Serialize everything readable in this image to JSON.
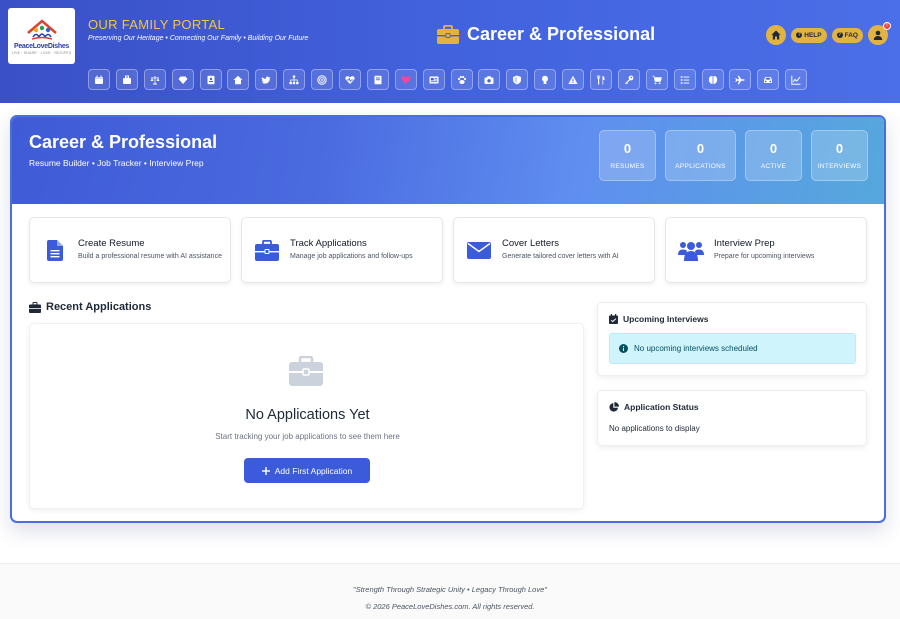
{
  "header": {
    "logo": {
      "brand": "PeaceLoveDishes",
      "tagline": "LIVE · SHARE · LOVE · RECIPES"
    },
    "portal_title": "OUR FAMILY PORTAL",
    "tagline": "Preserving Our Heritage • Connecting Our Family • Building Our Future",
    "page_title": "Career & Professional",
    "page_icon": "briefcase-icon",
    "buttons": {
      "home": "home-icon",
      "help": "HELP",
      "faq": "FAQ",
      "user": "user-icon"
    },
    "notification_badge": "!",
    "nav_icons": [
      "calendar",
      "briefcase",
      "scale",
      "gem",
      "id-card",
      "home",
      "twitter",
      "sitemap",
      "target",
      "heartbeat",
      "book",
      "heart",
      "newspaper",
      "paw",
      "camera",
      "shield",
      "lightbulb",
      "warning",
      "utensils",
      "key",
      "cart",
      "list",
      "brain",
      "plane",
      "car",
      "chart"
    ]
  },
  "hero": {
    "title": "Career & Professional",
    "subtitle": "Resume Builder • Job Tracker • Interview Prep",
    "stats": [
      {
        "value": "0",
        "label": "RESUMES"
      },
      {
        "value": "0",
        "label": "APPLICATIONS"
      },
      {
        "value": "0",
        "label": "ACTIVE"
      },
      {
        "value": "0",
        "label": "INTERVIEWS"
      }
    ]
  },
  "actions": [
    {
      "title": "Create Resume",
      "desc": "Build a professional resume with AI assistance",
      "icon": "document-icon"
    },
    {
      "title": "Track Applications",
      "desc": "Manage job applications and follow-ups",
      "icon": "briefcase-icon"
    },
    {
      "title": "Cover Letters",
      "desc": "Generate tailored cover letters with AI",
      "icon": "envelope-icon"
    },
    {
      "title": "Interview Prep",
      "desc": "Prepare for upcoming interviews",
      "icon": "users-icon"
    }
  ],
  "recent": {
    "heading": "Recent Applications",
    "empty_title": "No Applications Yet",
    "empty_desc": "Start tracking your job applications to see them here",
    "button": "Add First Application"
  },
  "interviews": {
    "heading": "Upcoming Interviews",
    "message": "No upcoming interviews scheduled"
  },
  "status": {
    "heading": "Application Status",
    "message": "No applications to display"
  },
  "footer": {
    "quote": "\"Strength Through Strategic Unity • Legacy Through Love\"",
    "copyright": "© 2026 PeaceLoveDishes.com. All rights reserved."
  },
  "colors": {
    "accent": "#3b5bdb",
    "gold": "#e3b341",
    "info_bg": "#cff4fc",
    "header_blue": "#4262dd"
  }
}
